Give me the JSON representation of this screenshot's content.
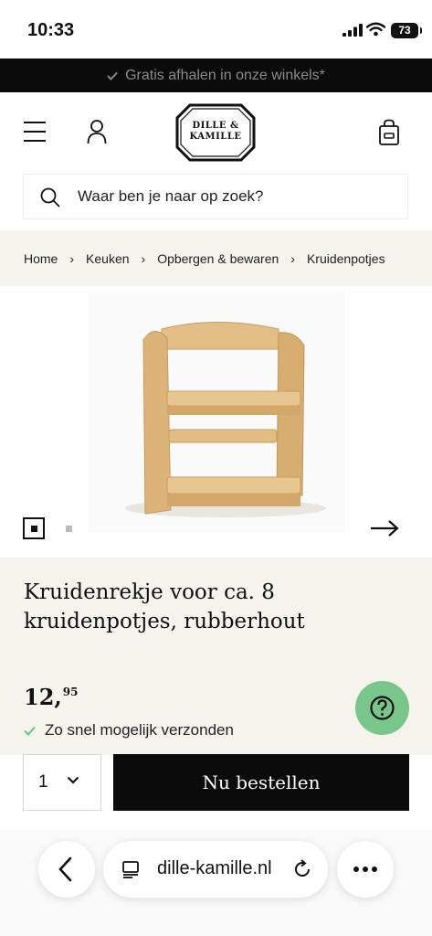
{
  "status": {
    "time": "10:33",
    "battery": "73"
  },
  "promo": {
    "text": "Gratis afhalen in onze winkels*"
  },
  "header": {
    "logo_line1": "DILLE &",
    "logo_line2": "KAMILLE",
    "search_placeholder": "Waar ben je naar op zoek?"
  },
  "breadcrumb": [
    "Home",
    "Keuken",
    "Opbergen & bewaren",
    "Kruidenpotjes"
  ],
  "gallery": {
    "image_count": 2,
    "current_index": 1
  },
  "product": {
    "title_line1": "Kruidenrekje voor ca. 8",
    "title_line2": "kruidenpotjes, rubberhout",
    "price_main": "12,",
    "price_cents": "95",
    "shipping": "Zo snel mogelijk verzonden"
  },
  "order": {
    "quantity": "1",
    "button_label": "Nu bestellen"
  },
  "browser": {
    "url": "dille-kamille.nl"
  },
  "colors": {
    "promo_bg": "#0b0b0b",
    "beige": "#f4f3ec",
    "help_green": "#79c68a",
    "buy_bg": "#0b0b0b"
  }
}
